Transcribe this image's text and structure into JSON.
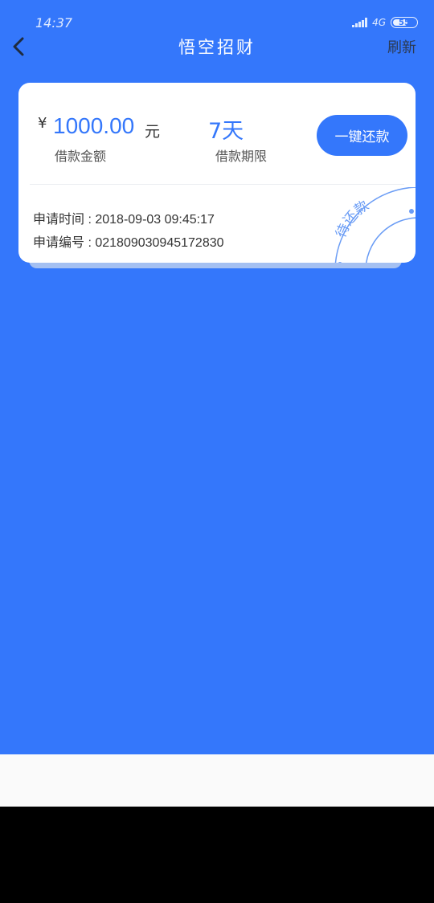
{
  "status_bar": {
    "time": "14:37",
    "network": "4G",
    "battery": "55"
  },
  "nav": {
    "back_icon": "chevron-left-icon",
    "title": "悟空招财",
    "refresh_label": "刷新"
  },
  "loan_card": {
    "currency_symbol": "¥",
    "amount": "1000.00",
    "amount_unit": "元",
    "amount_label": "借款金额",
    "term": "7天",
    "term_label": "借款期限",
    "repay_button": "一键还款",
    "apply_time_label": "申请时间 : ",
    "apply_time": "2018-09-03 09:45:17",
    "apply_no_label": "申请编号 : ",
    "apply_no": "021809030945172830",
    "stamp_text": "待还款"
  },
  "colors": {
    "primary": "#3477fb",
    "card_bg": "#ffffff",
    "stamp": "#6a9cf5"
  }
}
